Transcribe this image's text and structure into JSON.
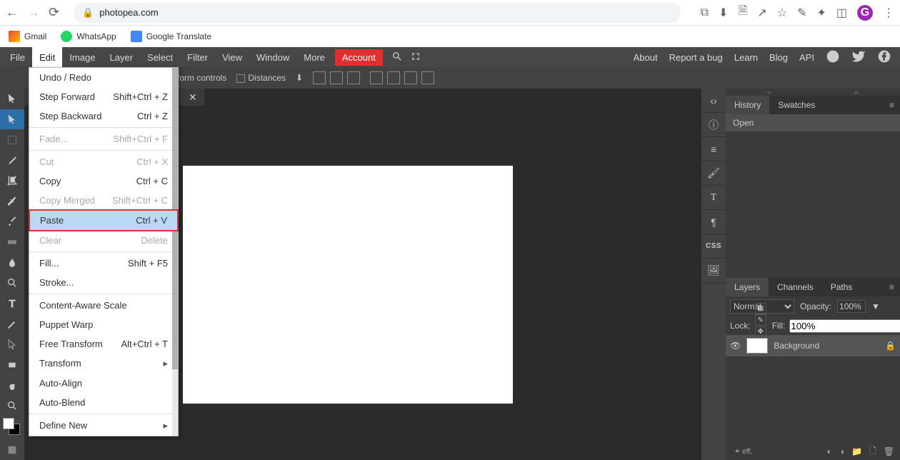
{
  "browser": {
    "url_host": "photopea.com",
    "avatar_letter": "G",
    "bookmarks": [
      {
        "label": "Gmail"
      },
      {
        "label": "WhatsApp"
      },
      {
        "label": "Google Translate"
      }
    ]
  },
  "menu": {
    "items": [
      "File",
      "Edit",
      "Image",
      "Layer",
      "Select",
      "Filter",
      "View",
      "Window",
      "More"
    ],
    "account": "Account",
    "right": [
      "About",
      "Report a bug",
      "Learn",
      "Blog",
      "API"
    ]
  },
  "options": {
    "transform_controls": "sform controls",
    "distances": "Distances"
  },
  "edit_menu": [
    {
      "label": "Undo / Redo",
      "shortcut": "",
      "disabled": false
    },
    {
      "label": "Step Forward",
      "shortcut": "Shift+Ctrl + Z",
      "disabled": false
    },
    {
      "label": "Step Backward",
      "shortcut": "Ctrl + Z",
      "disabled": false
    },
    {
      "sep": true
    },
    {
      "label": "Fade...",
      "shortcut": "Shift+Ctrl + F",
      "disabled": true
    },
    {
      "sep": true
    },
    {
      "label": "Cut",
      "shortcut": "Ctrl + X",
      "disabled": true
    },
    {
      "label": "Copy",
      "shortcut": "Ctrl + C",
      "disabled": false
    },
    {
      "label": "Copy Merged",
      "shortcut": "Shift+Ctrl + C",
      "disabled": true
    },
    {
      "label": "Paste",
      "shortcut": "Ctrl + V",
      "disabled": false,
      "highlighted": true
    },
    {
      "label": "Clear",
      "shortcut": "Delete",
      "disabled": true
    },
    {
      "sep": true
    },
    {
      "label": "Fill...",
      "shortcut": "Shift + F5",
      "disabled": false
    },
    {
      "label": "Stroke...",
      "shortcut": "",
      "disabled": false
    },
    {
      "sep": true
    },
    {
      "label": "Content-Aware Scale",
      "shortcut": "",
      "disabled": false
    },
    {
      "label": "Puppet Warp",
      "shortcut": "",
      "disabled": false
    },
    {
      "label": "Free Transform",
      "shortcut": "Alt+Ctrl + T",
      "disabled": false
    },
    {
      "label": "Transform",
      "shortcut": "",
      "submenu": true
    },
    {
      "label": "Auto-Align",
      "shortcut": "",
      "disabled": false
    },
    {
      "label": "Auto-Blend",
      "shortcut": "",
      "disabled": false
    },
    {
      "sep": true
    },
    {
      "label": "Define New",
      "shortcut": "",
      "submenu": true
    }
  ],
  "history": {
    "tabs": [
      "History",
      "Swatches"
    ],
    "item": "Open"
  },
  "layers": {
    "tabs": [
      "Layers",
      "Channels",
      "Paths"
    ],
    "blend_mode": "Normal",
    "opacity_label": "Opacity:",
    "opacity_value": "100%",
    "lock_label": "Lock:",
    "fill_label": "Fill:",
    "fill_value": "100%",
    "layer_name": "Background",
    "footer_eff": "eff,"
  }
}
